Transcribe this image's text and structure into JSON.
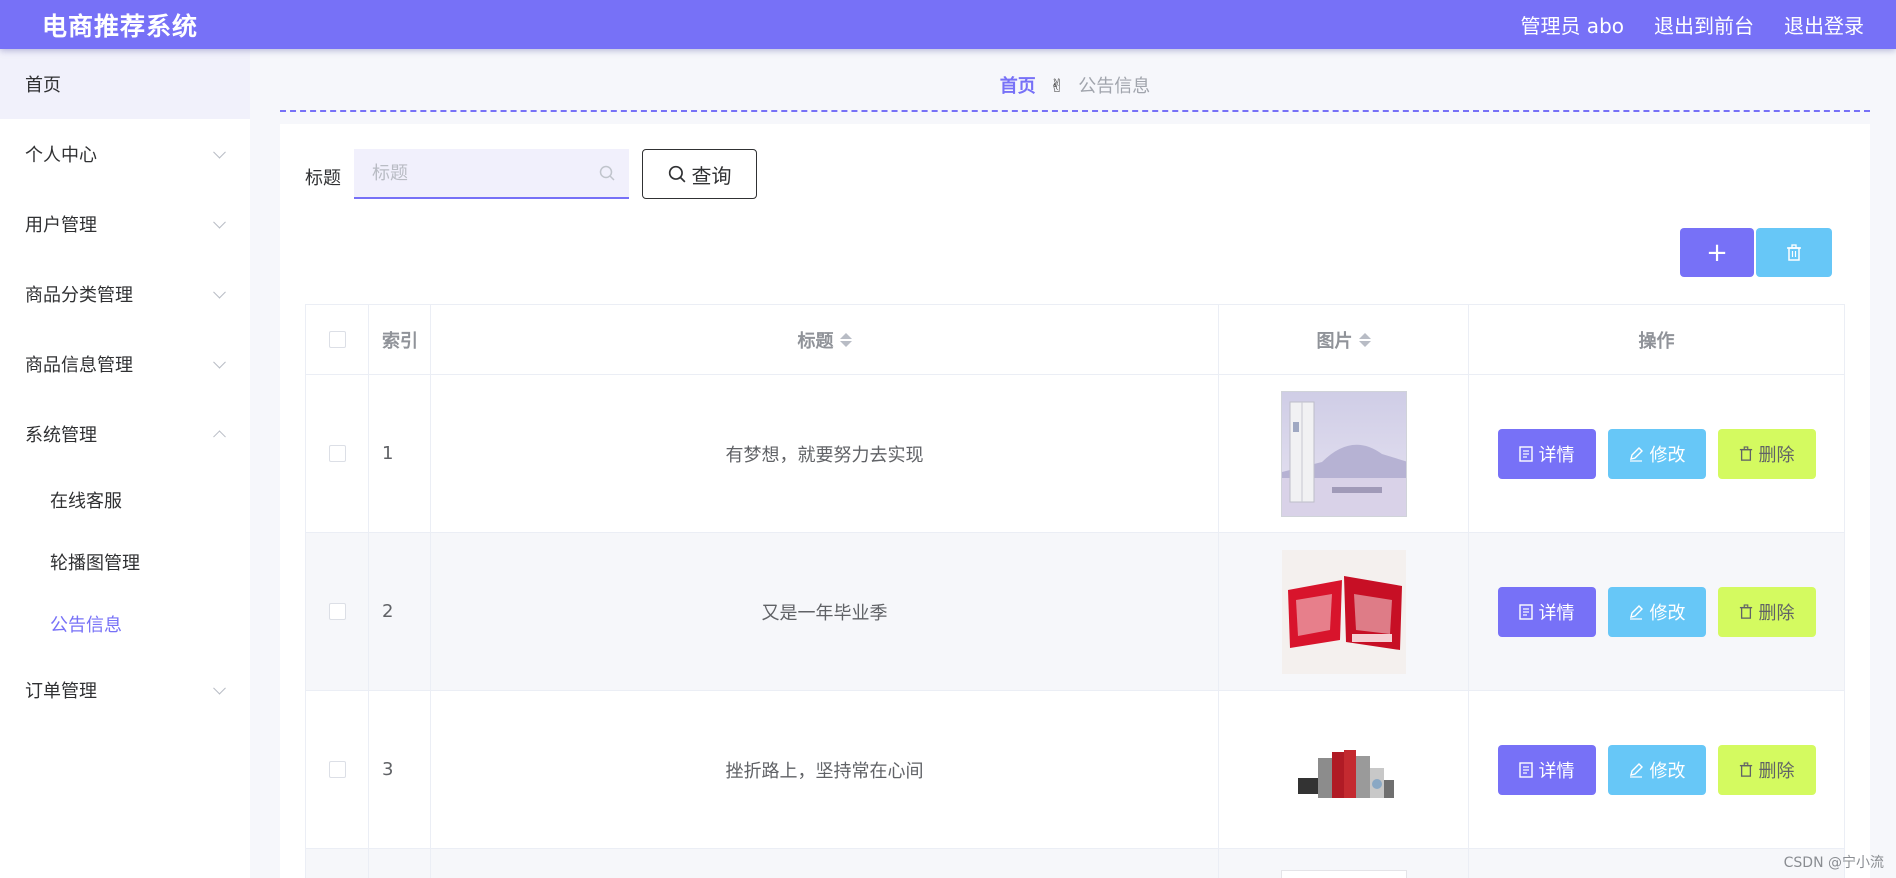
{
  "header": {
    "brand": "电商推荐系统",
    "admin": "管理员 abo",
    "to_front": "退出到前台",
    "logout": "退出登录"
  },
  "sidebar": {
    "items": [
      {
        "label": "首页"
      },
      {
        "label": "个人中心"
      },
      {
        "label": "用户管理"
      },
      {
        "label": "商品分类管理"
      },
      {
        "label": "商品信息管理"
      },
      {
        "label": "系统管理"
      },
      {
        "label": "订单管理"
      }
    ],
    "sub_items": [
      {
        "label": "在线客服"
      },
      {
        "label": "轮播图管理"
      },
      {
        "label": "公告信息"
      }
    ]
  },
  "breadcrumb": {
    "home": "首页",
    "separator": "✌",
    "current": "公告信息"
  },
  "search": {
    "label": "标题",
    "placeholder": "标题",
    "button": "查询"
  },
  "toolbar": {
    "add_icon": "plus-icon",
    "delete_icon": "trash-icon"
  },
  "table": {
    "headers": {
      "index": "索引",
      "title": "标题",
      "image": "图片",
      "ops": "操作"
    },
    "rows": [
      {
        "index": "1",
        "title": "有梦想，就要努力去实现"
      },
      {
        "index": "2",
        "title": "又是一年毕业季"
      },
      {
        "index": "3",
        "title": "挫折路上，坚持常在心间"
      }
    ],
    "actions": {
      "detail": "详情",
      "edit": "修改",
      "delete": "删除"
    }
  },
  "colors": {
    "primary": "#7771f7",
    "info": "#67c7f7",
    "warn": "#d4fa60"
  },
  "watermark": "CSDN @宁小流"
}
